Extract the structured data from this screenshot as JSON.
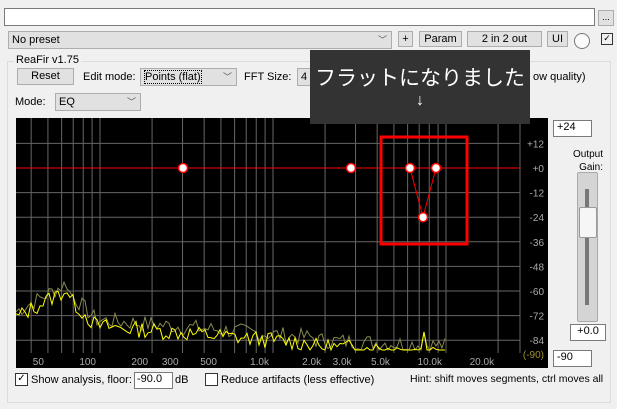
{
  "top": {
    "path_value": "",
    "browse_label": "...",
    "preset": "No preset",
    "plus_label": "+",
    "param_label": "Param",
    "io_label": "2 in 2 out",
    "ui_label": "UI"
  },
  "plugin": {
    "group_title": "ReaFir v1.75",
    "reset_label": "Reset",
    "edit_mode_label": "Edit mode:",
    "edit_mode_value": "Points (flat)",
    "fft_label": "FFT Size:",
    "fft_value": "4",
    "quality_text": "ow quality)",
    "mode_label": "Mode:",
    "mode_value": "EQ"
  },
  "tooltip": {
    "text": "フラットになりました",
    "arrow": "↓"
  },
  "graph": {
    "db_labels": [
      "+12",
      "+0",
      "-12",
      "-24",
      "-36",
      "-48",
      "-60",
      "-72",
      "-84"
    ],
    "floor_label": "(-90)",
    "freq_labels": [
      "50",
      "100",
      "200",
      "300",
      "500",
      "1.0k",
      "2.0k",
      "3.0k",
      "5.0k",
      "10.0k",
      "20.0k"
    ],
    "points_db": [
      0,
      0,
      0,
      -24,
      0
    ],
    "colors": {
      "curve": "#ff0000",
      "analysis": "#ffff00",
      "highlight": "#ff0000"
    }
  },
  "gain": {
    "max": "+24",
    "label": "Output Gain:",
    "value": "+0.0",
    "min": "-90"
  },
  "bottom": {
    "show_analysis_label": "Show analysis, floor:",
    "floor_value": "-90.0",
    "db_unit": "dB",
    "reduce_label": "Reduce artifacts (less effective)",
    "hint": "Hint: shift moves segments, ctrl moves all"
  }
}
